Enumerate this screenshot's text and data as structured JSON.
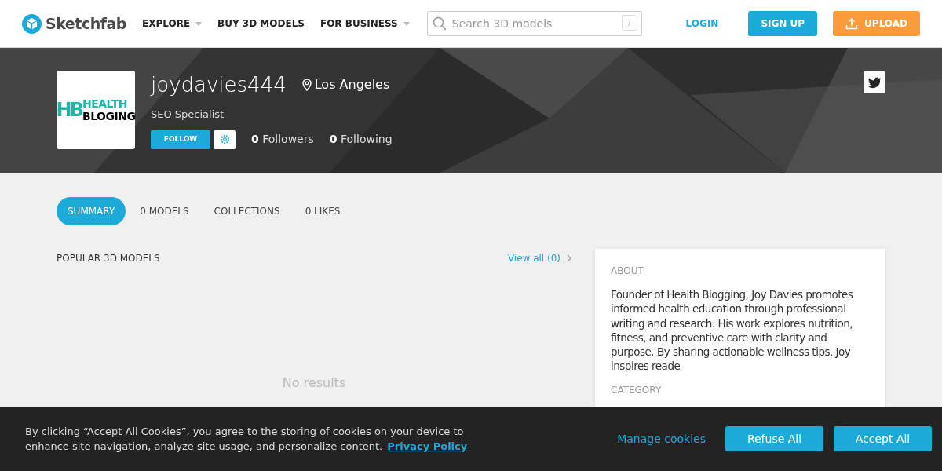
{
  "header": {
    "brand": "Sketchfab",
    "nav": [
      {
        "label": "EXPLORE",
        "dropdown": true
      },
      {
        "label": "BUY 3D MODELS",
        "dropdown": false
      },
      {
        "label": "FOR BUSINESS",
        "dropdown": true
      }
    ],
    "search": {
      "placeholder": "Search 3D models",
      "shortcut": "/"
    },
    "login": "LOGIN",
    "signup": "SIGN UP",
    "upload": "UPLOAD"
  },
  "profile": {
    "avatar_lines": [
      "HEALTH",
      "BLOGING"
    ],
    "avatar_mark": "HB",
    "username": "joydavies444",
    "location": "Los Angeles",
    "title": "SEO Specialist",
    "follow": "FOLLOW",
    "followers_count": "0",
    "followers_label": "Followers",
    "following_count": "0",
    "following_label": "Following"
  },
  "tabs": [
    {
      "label": "SUMMARY",
      "selected": true
    },
    {
      "label": "0 MODELS",
      "selected": false
    },
    {
      "label": "COLLECTIONS",
      "selected": false
    },
    {
      "label": "0 LIKES",
      "selected": false
    }
  ],
  "popular": {
    "heading": "POPULAR 3D MODELS",
    "view_all": "View all (0)",
    "empty": "No results"
  },
  "about": {
    "heading": "ABOUT",
    "text": "Founder of Health Blogging, Joy Davies promotes informed health education through professional writing and research. His work explores nutrition, fitness, and preventive care with clarity and purpose. By sharing actionable wellness tips, Joy inspires reade",
    "category_heading": "CATEGORY"
  },
  "cookie_bar": {
    "text": "By clicking “Accept All Cookies”, you agree to the storing of cookies on your device to enhance site navigation, analyze site usage, and personalize content.",
    "policy_link": "Privacy Policy",
    "manage": "Manage cookies",
    "refuse": "Refuse All",
    "accept": "Accept All"
  }
}
